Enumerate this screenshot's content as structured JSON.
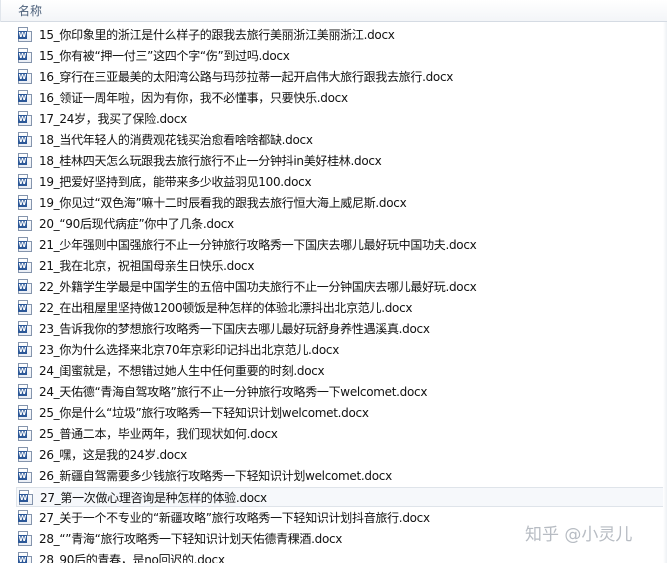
{
  "header": {
    "column_label": "名称"
  },
  "file_icon": {
    "name": "word-doc-icon",
    "badge": "W"
  },
  "files": [
    {
      "name": "15_你印象里的浙江是什么样子的跟我去旅行美丽浙江美丽浙江.docx"
    },
    {
      "name": "15_你有被“押一付三”这四个字“伤”到过吗.docx"
    },
    {
      "name": "16_穿行在三亚最美的太阳湾公路与玛莎拉蒂一起开启伟大旅行跟我去旅行.docx"
    },
    {
      "name": "16_领证一周年啦，因为有你，我不必懂事，只要快乐.docx"
    },
    {
      "name": "17_24岁，我买了保险.docx"
    },
    {
      "name": "18_当代年轻人的消费观花钱买治愈看啥啥都缺.docx"
    },
    {
      "name": "18_桂林四天怎么玩跟我去旅行旅行不止一分钟抖in美好桂林.docx"
    },
    {
      "name": "19_把爱好坚持到底，能带来多少收益羽见100.docx"
    },
    {
      "name": "19_你见过“双色海”嘛十二时辰看我的跟我去旅行恒大海上威尼斯.docx"
    },
    {
      "name": "20_“90后现代病症”你中了几条.docx"
    },
    {
      "name": "21_少年强则中国强旅行不止一分钟旅行攻略秀一下国庆去哪儿最好玩中国功夫.docx"
    },
    {
      "name": "21_我在北京，祝祖国母亲生日快乐.docx"
    },
    {
      "name": "22_外籍学生学最是中国学生的五倍中国功夫旅行不止一分钟国庆去哪儿最好玩.docx"
    },
    {
      "name": "22_在出租屋里坚持做1200顿饭是种怎样的体验北漂抖出北京范儿.docx"
    },
    {
      "name": "23_告诉我你的梦想旅行攻略秀一下国庆去哪儿最好玩舒身养性遇溪真.docx"
    },
    {
      "name": "23_你为什么选择来北京70年京彩印记抖出北京范儿.docx"
    },
    {
      "name": "24_闺蜜就是，不想错过她人生中任何重要的时刻.docx"
    },
    {
      "name": "24_天佑德“青海自驾攻略”旅行不止一分钟旅行攻略秀一下welcomet.docx"
    },
    {
      "name": "25_你是什么“垃圾”旅行攻略秀一下轻知识计划welcomet.docx"
    },
    {
      "name": "25_普通二本，毕业两年，我们现状如何.docx"
    },
    {
      "name": "26_嘿，这是我的24岁.docx"
    },
    {
      "name": "26_新疆自驾需要多少钱旅行攻略秀一下轻知识计划welcomet.docx"
    },
    {
      "name": "27_第一次做心理咨询是种怎样的体验.docx",
      "selected": true
    },
    {
      "name": "27_关于一个不专业的“新疆攻略”旅行攻略秀一下轻知识计划抖音旅行.docx"
    },
    {
      "name": "28_“”青海“旅行攻略秀一下轻知识计划天佑德青稞酒.docx"
    },
    {
      "name": "28_90后的青春，是no回迟的.docx"
    }
  ],
  "watermark": {
    "text": "知乎 @小灵儿"
  }
}
